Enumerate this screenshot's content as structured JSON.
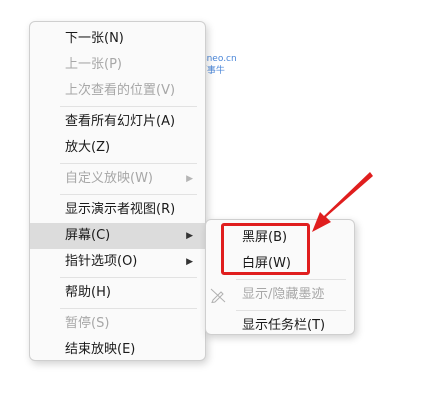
{
  "watermark": {
    "line1": "passneo.cn",
    "line2": "百事牛"
  },
  "main_menu": {
    "items": [
      {
        "label": "下一张(N)",
        "disabled": false
      },
      {
        "label": "上一张(P)",
        "disabled": true
      },
      {
        "label": "上次查看的位置(V)",
        "disabled": true
      },
      {
        "label": "查看所有幻灯片(A)",
        "disabled": false
      },
      {
        "label": "放大(Z)",
        "disabled": false
      },
      {
        "label": "自定义放映(W)",
        "disabled": true,
        "submenu": true
      },
      {
        "label": "显示演示者视图(R)",
        "disabled": false
      },
      {
        "label": "屏幕(C)",
        "disabled": false,
        "submenu": true,
        "highlighted": true
      },
      {
        "label": "指针选项(O)",
        "disabled": false,
        "submenu": true
      },
      {
        "label": "帮助(H)",
        "disabled": false
      },
      {
        "label": "暂停(S)",
        "disabled": true
      },
      {
        "label": "结束放映(E)",
        "disabled": false
      }
    ]
  },
  "sub_menu": {
    "items": [
      {
        "label": "黑屏(B)",
        "disabled": false
      },
      {
        "label": "白屏(W)",
        "disabled": false
      },
      {
        "label": "显示/隐藏墨迹",
        "disabled": true,
        "icon": "pen-slash-icon"
      },
      {
        "label": "显示任务栏(T)",
        "disabled": false
      }
    ]
  },
  "colors": {
    "callout": "#e01e1e",
    "highlight": "#dcdcdc",
    "disabled_text": "#a7a7a7"
  }
}
